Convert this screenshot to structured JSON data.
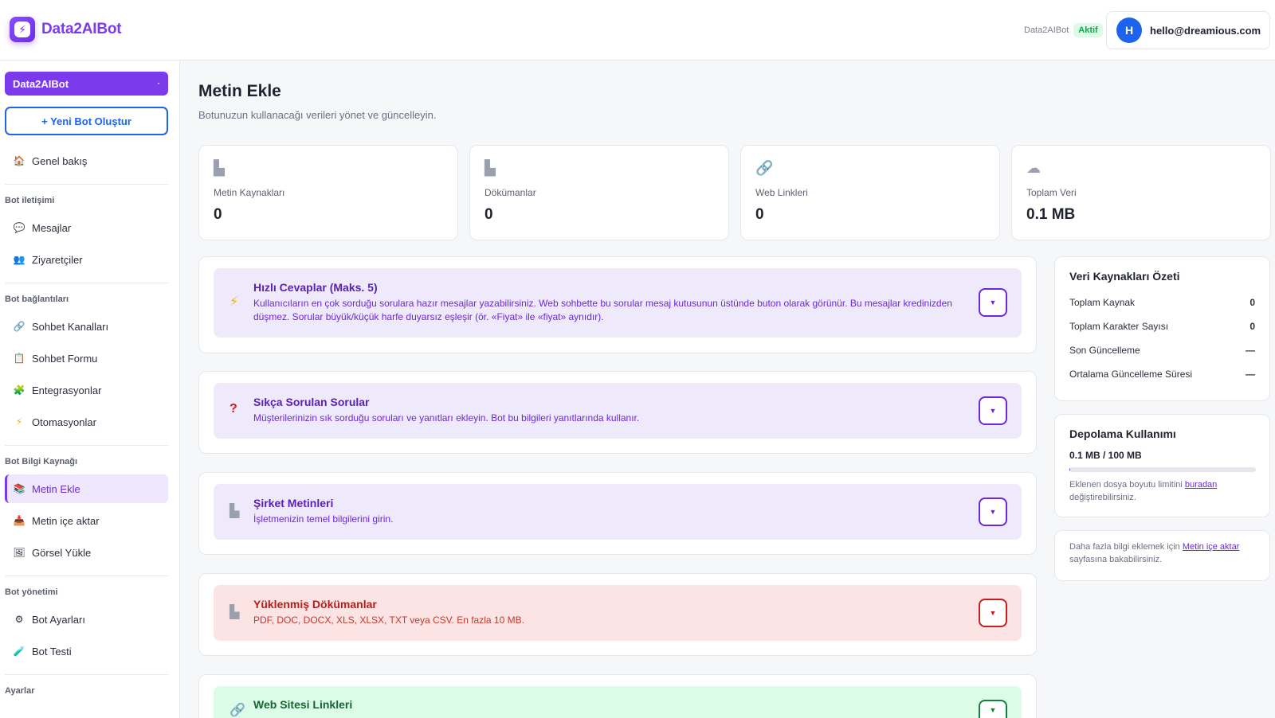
{
  "header": {
    "brand": "Data2AIBot",
    "brand_logo_icon": "bolt-icon",
    "bot_name": "Data2AIBot",
    "status_badge": "Aktif",
    "user_initial": "H",
    "user_email": "hello@dreamious.com"
  },
  "sidebar": {
    "bot_select": "Data2AIBot",
    "new_bot": "+ Yeni Bot Oluştur",
    "overview": "Genel bakış",
    "sections": {
      "iletisim": "Bot iletişimi",
      "baglantilar": "Bot bağlantıları",
      "kaynak": "Bot Bilgi Kaynağı",
      "yonetim": "Bot yönetimi",
      "ayarlar": "Ayarlar"
    },
    "items": {
      "mesajlar": "Mesajlar",
      "ziyaretciler": "Ziyaretçiler",
      "sohbet_kanallari": "Sohbet Kanalları",
      "sohbet_formu": "Sohbet Formu",
      "entegrasyonlar": "Entegrasyonlar",
      "otomasyonlar": "Otomasyonlar",
      "metin_ekle": "Metin Ekle",
      "metin_ice_aktar": "Metin içe aktar",
      "gorsel_yukle": "Görsel Yükle",
      "bot_ayarlari": "Bot Ayarları",
      "bot_testi": "Bot Testi"
    }
  },
  "main": {
    "title": "Metin Ekle",
    "subtitle": "Botunuzun kullanacağı verileri yönet ve güncelleyin.",
    "stats": [
      {
        "label": "Metin Kaynakları",
        "value": "0",
        "icon": "document-icon"
      },
      {
        "label": "Dökümanlar",
        "value": "0",
        "icon": "document-icon"
      },
      {
        "label": "Web Linkleri",
        "value": "0",
        "icon": "link-icon"
      },
      {
        "label": "Toplam Veri",
        "value": "0.1 MB",
        "icon": "cloud-icon"
      }
    ],
    "sections": [
      {
        "title": "Hızlı Cevaplar (Maks. 5)",
        "desc": "Kullanıcıların en çok sorduğu sorulara hazır mesajlar yazabilirsiniz. Web sohbette bu sorular mesaj kutusunun üstünde buton olarak görünür. Bu mesajlar kredinizden düşmez. Sorular büyük/küçük harfe duyarsız eşleşir (ör. «Fiyat» ile «fiyat» aynıdır).",
        "icon": "lightning-icon"
      },
      {
        "title": "Sıkça Sorulan Sorular",
        "desc": "Müşterilerinizin sık sorduğu soruları ve yanıtları ekleyin. Bot bu bilgileri yanıtlarında kullanır.",
        "icon": "question-icon"
      },
      {
        "title": "Şirket Metinleri",
        "desc": "İşletmenizin temel bilgilerini girin.",
        "icon": "document-icon"
      },
      {
        "title": "Yüklenmiş Dökümanlar",
        "desc": "PDF, DOC, DOCX, XLS, XLSX, TXT veya CSV. En fazla 10 MB.",
        "icon": "document-icon"
      },
      {
        "title": "Web Sitesi Linkleri",
        "icon": "link-icon"
      }
    ]
  },
  "right_panel": {
    "summary_title": "Veri Kaynakları Özeti",
    "rows": [
      {
        "label": "Toplam Kaynak",
        "value": "0"
      },
      {
        "label": "Toplam Karakter Sayısı",
        "value": "0"
      },
      {
        "label": "Son Güncelleme",
        "value": "—"
      },
      {
        "label": "Ortalama Güncelleme Süresi",
        "value": "—"
      }
    ],
    "storage_title": "Depolama Kullanımı",
    "storage_value": "0.1 MB / 100 MB",
    "storage_fraction": 0.001,
    "storage_note_pre": "Eklenen dosya boyutu limitini ",
    "storage_note_link": "buradan",
    "storage_note_post": " değiştirebilirsiniz.",
    "info_pre": "Daha fazla bilgi eklemek için ",
    "info_link": "Metin içe aktar",
    "info_post": " sayfasına bakabilirsiniz."
  },
  "colors": {
    "accent": "#7c3aed",
    "primary_blue": "#1d63ed",
    "success": "#16a34a"
  }
}
